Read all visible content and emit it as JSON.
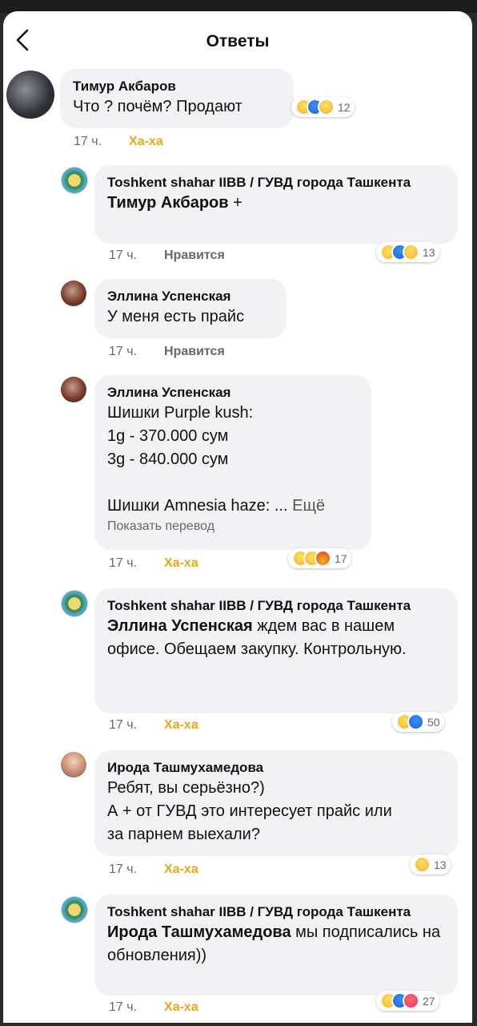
{
  "header": {
    "title": "Ответы",
    "back_icon": "chevron-left-icon"
  },
  "comments": [
    {
      "author": "Тимур Акбаров",
      "text": "Что ? почём? Продают",
      "time": "17 ч.",
      "action": "Ха-ха",
      "reactions": [
        "haha",
        "like",
        "wow"
      ],
      "count": "12"
    },
    {
      "author": "Toshkent shahar IIBB / ГУВД города Ташкента",
      "mention": "Тимур Акбаров",
      "text": " +",
      "time": "17 ч.",
      "action": "Нравится",
      "reactions": [
        "haha",
        "like",
        "wow"
      ],
      "count": "13"
    },
    {
      "author": "Эллина Успенская",
      "text": "У меня есть прайс",
      "time": "17 ч.",
      "action": "Нравится"
    },
    {
      "author": "Эллина Успенская",
      "lines": [
        "Шишки Purple kush:",
        "1g - 370.000 сум",
        "3g - 840.000 сум",
        "",
        "Шишки Amnesia haze: ..."
      ],
      "more": "Ещё",
      "translate": "Показать перевод",
      "time": "17 ч.",
      "action": "Ха-ха",
      "reactions": [
        "wow",
        "haha",
        "angry"
      ],
      "count": "17"
    },
    {
      "author": "Toshkent shahar IIBB / ГУВД города Ташкента",
      "mention": "Эллина Успенская",
      "text": " ждем вас в нашем офисе. Обещаем закупку. Контрольную.",
      "time": "17 ч.",
      "action": "Ха-ха",
      "reactions": [
        "haha",
        "like"
      ],
      "count": "50"
    },
    {
      "author": "Ирода Ташмухамедова",
      "lines": [
        "Ребят, вы серьёзно?)",
        "А + от ГУВД это интересует прайс или",
        "за парнем выехали?"
      ],
      "time": "17 ч.",
      "action": "Ха-ха",
      "reactions": [
        "haha"
      ],
      "count": "13"
    },
    {
      "author": "Toshkent shahar IIBB / ГУВД города Ташкента",
      "mention": "Ирода Ташмухамедова",
      "text": " мы подписались на обновления))",
      "time": "17 ч.",
      "action": "Ха-ха",
      "reactions": [
        "haha",
        "like",
        "love"
      ],
      "count": "27"
    }
  ]
}
